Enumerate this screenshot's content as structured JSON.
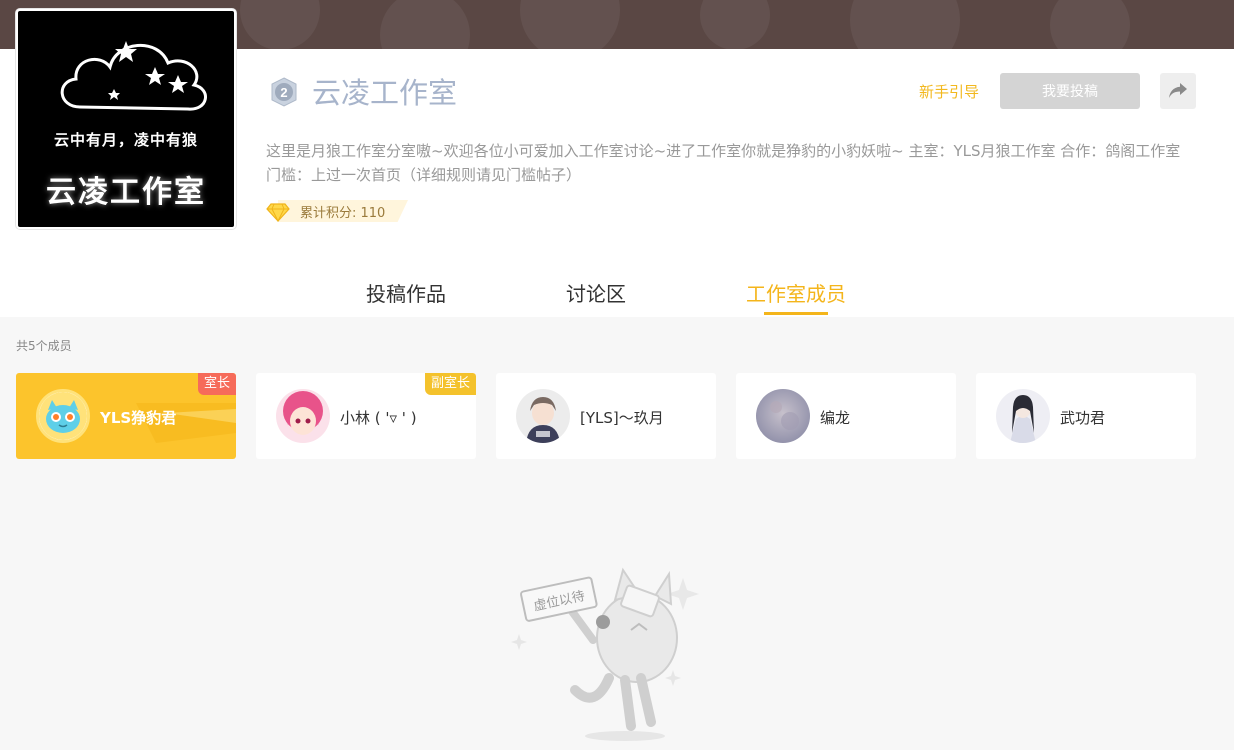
{
  "studio": {
    "name": "云凌工作室",
    "level": "2",
    "logo_motto": "云中有月，凌中有狼",
    "logo_name": "云凌工作室",
    "description": "这里是月狼工作室分室嗷~欢迎各位小可爱加入工作室讨论~进了工作室你就是狰豹的小豹妖啦~ 主室：YLS月狼工作室 合作：鸽阁工作室 门槛：上过一次首页（详细规则请见门槛帖子）",
    "score_label": "累计积分: 110"
  },
  "actions": {
    "guide": "新手引导",
    "submit": "我要投稿"
  },
  "tabs": [
    {
      "label": "投稿作品"
    },
    {
      "label": "讨论区"
    },
    {
      "label": "工作室成员"
    }
  ],
  "members": {
    "count_label": "共5个成员",
    "items": [
      {
        "name": "YLS狰豹君",
        "role": "室长"
      },
      {
        "name": "小林 ( '▿ ' )",
        "role": "副室长"
      },
      {
        "name": "[YLS]～玖月",
        "role": ""
      },
      {
        "name": "编龙",
        "role": ""
      },
      {
        "name": "武功君",
        "role": ""
      }
    ]
  },
  "empty_state": {
    "sign_text": "虚位以待"
  },
  "colors": {
    "accent": "#f4b51b",
    "owner_card": "#fcc42c",
    "owner_badge": "#f66b5a",
    "title": "#a7b4cb"
  }
}
